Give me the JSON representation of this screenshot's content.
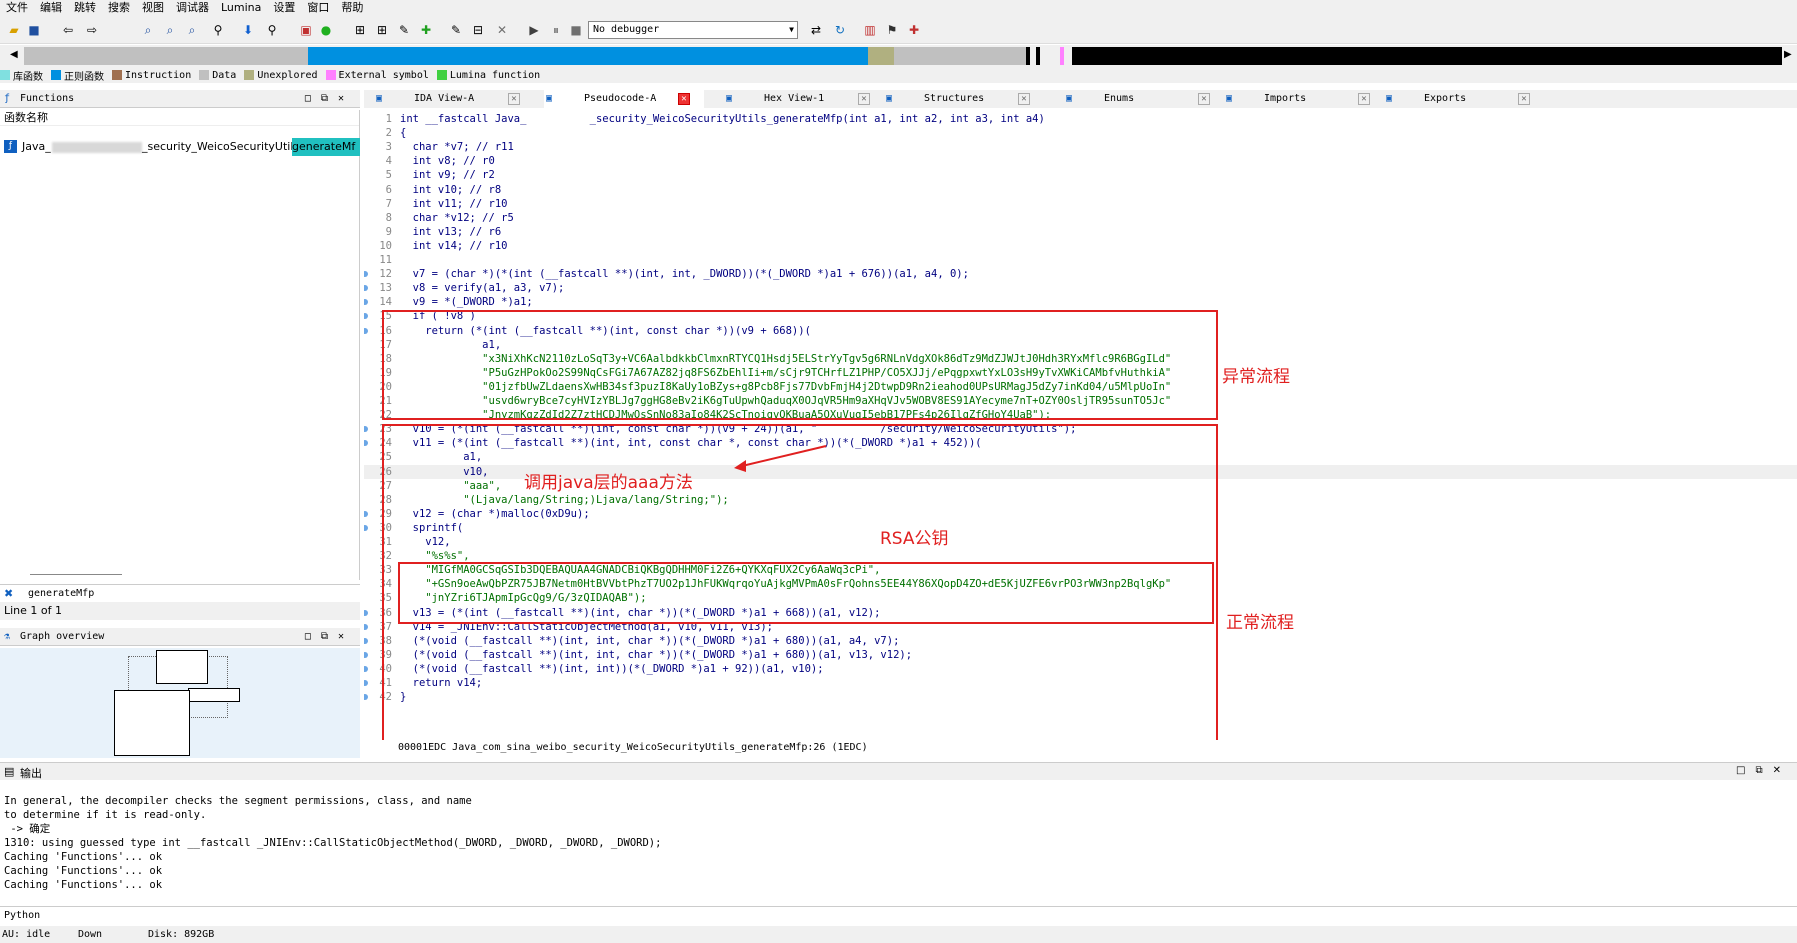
{
  "menu": [
    "文件",
    "编辑",
    "跳转",
    "搜索",
    "视图",
    "调试器",
    "Lumina",
    "设置",
    "窗口",
    "帮助"
  ],
  "toolbar": {
    "debugger": "No debugger"
  },
  "legend": [
    {
      "label": "库函数",
      "color": "#80e0e0"
    },
    {
      "label": "正则函数",
      "color": "#0090e0"
    },
    {
      "label": "Instruction",
      "color": "#a07050"
    },
    {
      "label": "Data",
      "color": "#c0c0c0"
    },
    {
      "label": "Unexplored",
      "color": "#b0b080"
    },
    {
      "label": "External symbol",
      "color": "#ff80ff"
    },
    {
      "label": "Lumina function",
      "color": "#40d040"
    }
  ],
  "functions_panel": {
    "title": "Functions",
    "column": "函数名称",
    "item_prefix": "Java_",
    "item_mid": "_security_WeicoSecurityUtils_",
    "item_highlight": "generateMf",
    "filter": "generateMfp",
    "line_count": "Line 1 of 1"
  },
  "graph_overview": {
    "title": "Graph overview"
  },
  "tabs": [
    "IDA View-A",
    "Pseudocode-A",
    "Hex View-1",
    "Structures",
    "Enums",
    "Imports",
    "Exports"
  ],
  "code_lines": [
    {
      "n": "1",
      "t": "int __fastcall Java_          _security_WeicoSecurityUtils_generateMfp(int a1, int a2, int a3, int a4)",
      "bp": false
    },
    {
      "n": "2",
      "t": "{",
      "bp": false
    },
    {
      "n": "3",
      "t": "  char *v7; // r11",
      "bp": false
    },
    {
      "n": "4",
      "t": "  int v8; // r0",
      "bp": false
    },
    {
      "n": "5",
      "t": "  int v9; // r2",
      "bp": false
    },
    {
      "n": "6",
      "t": "  int v10; // r8",
      "bp": false
    },
    {
      "n": "7",
      "t": "  int v11; // r10",
      "bp": false
    },
    {
      "n": "8",
      "t": "  char *v12; // r5",
      "bp": false
    },
    {
      "n": "9",
      "t": "  int v13; // r6",
      "bp": false
    },
    {
      "n": "10",
      "t": "  int v14; // r10",
      "bp": false
    },
    {
      "n": "11",
      "t": "",
      "bp": false
    },
    {
      "n": "12",
      "t": "  v7 = (char *)(*(int (__fastcall **)(int, int, _DWORD))(*(_DWORD *)a1 + 676))(a1, a4, 0);",
      "bp": true
    },
    {
      "n": "13",
      "t": "  v8 = verify(a1, a3, v7);",
      "bp": true
    },
    {
      "n": "14",
      "t": "  v9 = *(_DWORD *)a1;",
      "bp": true
    },
    {
      "n": "15",
      "t": "  if ( !v8 )",
      "bp": true
    },
    {
      "n": "16",
      "t": "    return (*(int (__fastcall **)(int, const char *))(v9 + 668))(",
      "bp": true
    },
    {
      "n": "17",
      "t": "             a1,",
      "bp": false
    },
    {
      "n": "18",
      "t": "             \"x3NiXhKcN2110zLoSqT3y+VC6AalbdkkbClmxnRTYCQ1Hsdj5ELStrYyTgv5g6RNLnVdgXOk86dTz9MdZJWJtJ0Hdh3RYxMflc9R6BGgILd\"",
      "bp": false
    },
    {
      "n": "19",
      "t": "             \"P5uGzHPokOo2S99NqCsFGi7A67AZ82jq8FS6ZbEhlIi+m/sCjr9TCHrfLZ1PHP/CO5XJJj/ePqgpxwtYxLO3sH9yTvXWKiCAMbfvHuthkiA\"",
      "bp": false
    },
    {
      "n": "20",
      "t": "             \"01jzfbUwZLdaensXwHB34sf3puzI8KaUy1oBZys+g8Pcb8Fjs77DvbFmjH4j2DtwpD9Rn2ieahod0UPsURMagJ5dZy7inKd04/u5MlpUoIn\"",
      "bp": false
    },
    {
      "n": "21",
      "t": "             \"usvd6wryBce7cyHVIzYBLJg7ggHG8eBv2iK6gTuUpwhQaduqX0OJqVR5Hm9aXHqVJv5WOBV8ES91AYecyme7nT+OZY0OsljTR95sunTO5Jc\"",
      "bp": false
    },
    {
      "n": "22",
      "t": "             \"JnyzmKqzZdId2Z7ztHCDJMwOsSnNo83aIo84K2ScTnoiqvQKBuaA5OXuVugI5ebB17PFs4p26IlgZfGHoY4UaB\");",
      "bp": false
    },
    {
      "n": "23",
      "t": "  v10 = (*(int (__fastcall **)(int, const char *))(v9 + 24))(a1, \"          /security/WeicoSecurityUtils\");",
      "bp": true
    },
    {
      "n": "24",
      "t": "  v11 = (*(int (__fastcall **)(int, int, const char *, const char *))(*(_DWORD *)a1 + 452))(",
      "bp": true
    },
    {
      "n": "25",
      "t": "          a1,",
      "bp": false
    },
    {
      "n": "26",
      "t": "          v10,",
      "bp": false
    },
    {
      "n": "27",
      "t": "          \"aaa\",",
      "bp": false
    },
    {
      "n": "28",
      "t": "          \"(Ljava/lang/String;)Ljava/lang/String;\");",
      "bp": false
    },
    {
      "n": "29",
      "t": "  v12 = (char *)malloc(0xD9u);",
      "bp": true
    },
    {
      "n": "30",
      "t": "  sprintf(",
      "bp": true
    },
    {
      "n": "31",
      "t": "    v12,",
      "bp": false
    },
    {
      "n": "32",
      "t": "    \"%s%s\",",
      "bp": false
    },
    {
      "n": "33",
      "t": "    \"MIGfMA0GCSqGSIb3DQEBAQUAA4GNADCBiQKBgQDHHM0Fi2Z6+QYKXqFUX2Cy6AaWq3cPi\",",
      "bp": false
    },
    {
      "n": "34",
      "t": "    \"+GSn9oeAwQbPZR75JB7Netm0HtBVVbtPhzT7UO2p1JhFUKWqrqoYuAjkgMVPmA0sFrQohns5EE44Y86XQopD4ZO+dE5KjUZFE6vrPO3rWW3np2BqlgKp\"",
      "bp": false
    },
    {
      "n": "35",
      "t": "    \"jnYZri6TJApmIpGcQg9/G/3zQIDAQAB\");",
      "bp": false
    },
    {
      "n": "36",
      "t": "  v13 = (*(int (__fastcall **)(int, char *))(*(_DWORD *)a1 + 668))(a1, v12);",
      "bp": true
    },
    {
      "n": "37",
      "t": "  v14 = _JNIEnv::CallStaticObjectMethod(a1, v10, v11, v13);",
      "bp": true
    },
    {
      "n": "38",
      "t": "  (*(void (__fastcall **)(int, int, char *))(*(_DWORD *)a1 + 680))(a1, a4, v7);",
      "bp": true
    },
    {
      "n": "39",
      "t": "  (*(void (__fastcall **)(int, int, char *))(*(_DWORD *)a1 + 680))(a1, v13, v12);",
      "bp": true
    },
    {
      "n": "40",
      "t": "  (*(void (__fastcall **)(int, int))(*(_DWORD *)a1 + 92))(a1, v10);",
      "bp": true
    },
    {
      "n": "41",
      "t": "  return v14;",
      "bp": true
    },
    {
      "n": "42",
      "t": "}",
      "bp": true
    }
  ],
  "annotations": {
    "abnormal": "异常流程",
    "call_java": "调用java层的aaa方法",
    "rsa": "RSA公钥",
    "normal": "正常流程"
  },
  "code_status": "00001EDC Java_com_sina_weibo_security_WeicoSecurityUtils_generateMfp:26 (1EDC)",
  "output": {
    "title": "输出",
    "lines": [
      "In general, the decompiler checks the segment permissions, class, and name",
      "to determine if it is read-only.",
      " -> 确定",
      "1310: using guessed type int __fastcall _JNIEnv::CallStaticObjectMethod(_DWORD, _DWORD, _DWORD, _DWORD);",
      "Caching 'Functions'... ok",
      "Caching 'Functions'... ok",
      "Caching 'Functions'... ok"
    ]
  },
  "python_label": "Python",
  "statusbar": {
    "au": "AU:  idle",
    "dir": "Down",
    "disk": "Disk: 892GB"
  }
}
